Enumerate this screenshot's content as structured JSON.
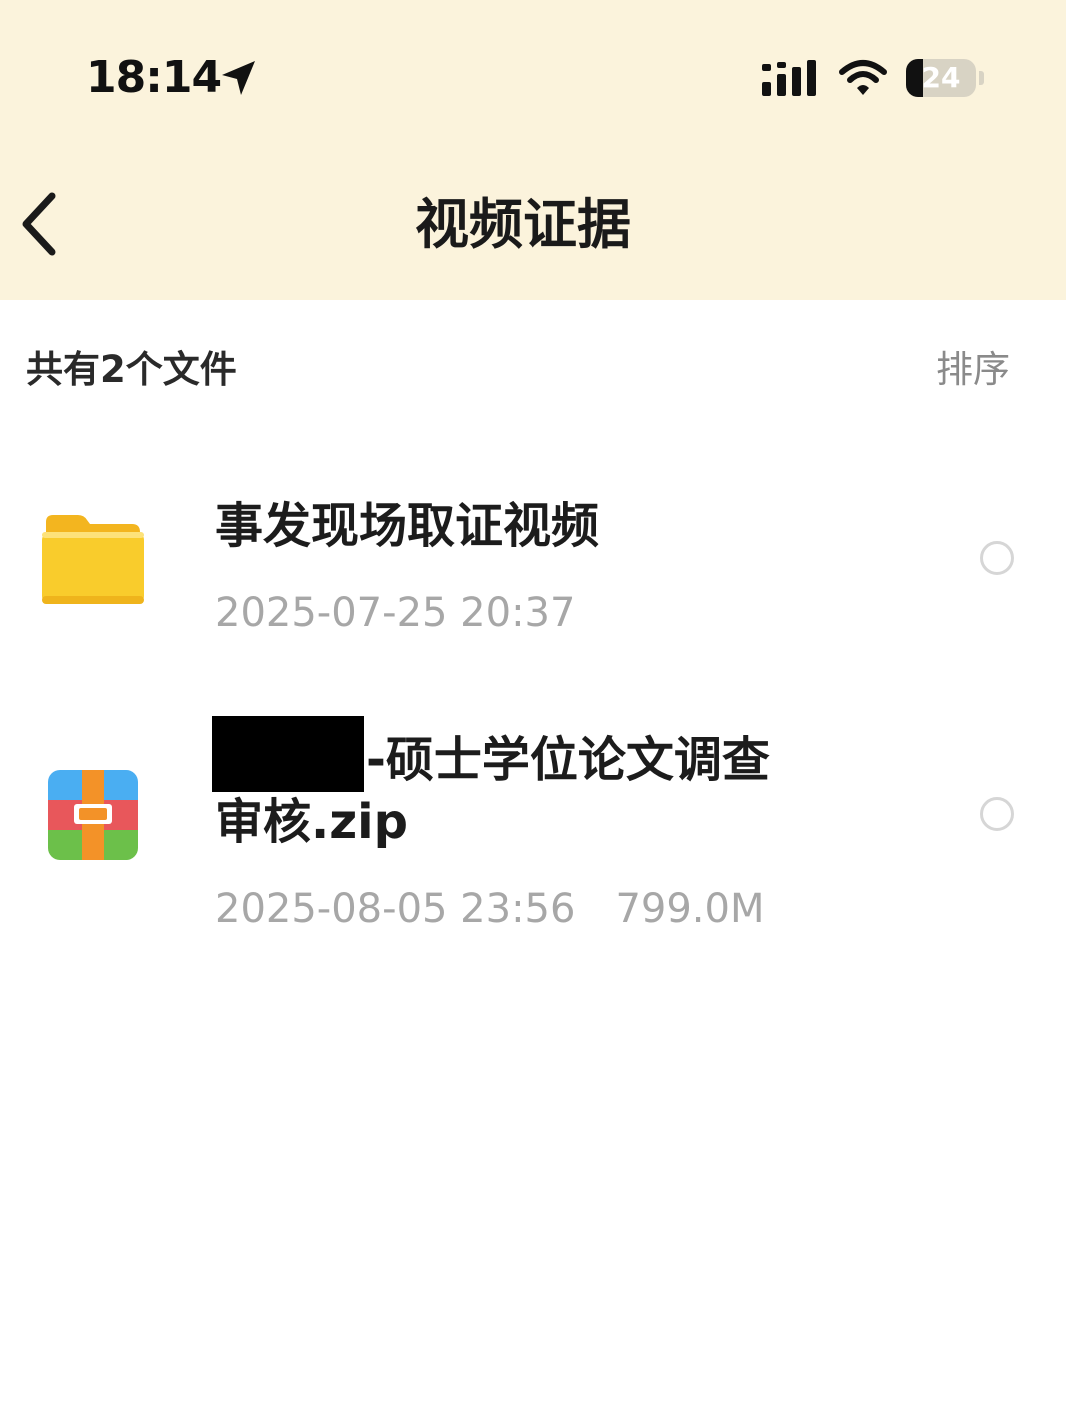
{
  "status_bar": {
    "time": "18:14",
    "location_icon": "location-arrow-icon",
    "signal_icon": "cellular-signal-icon",
    "wifi_icon": "wifi-icon",
    "battery_level": "24",
    "battery_fraction": 0.24
  },
  "header": {
    "back_icon": "chevron-left-icon",
    "title": "视频证据"
  },
  "toolbar": {
    "file_count_label": "共有2个文件",
    "sort_label": "排序"
  },
  "files": [
    {
      "icon": "folder-icon",
      "name": "事发现场取证视频",
      "date": "2025-07-25 20:37",
      "size": ""
    },
    {
      "icon": "zip-archive-icon",
      "name_line1": "-硕士学位论文调查",
      "name_line2": "审核.zip",
      "date": "2025-08-05 23:56",
      "size": "799.0M"
    }
  ],
  "colors": {
    "header_bg": "#fbf3dc",
    "page_bg": "#ffffff",
    "meta_text": "#a7a7a7",
    "folder_yellow": "#f9cc2c"
  }
}
